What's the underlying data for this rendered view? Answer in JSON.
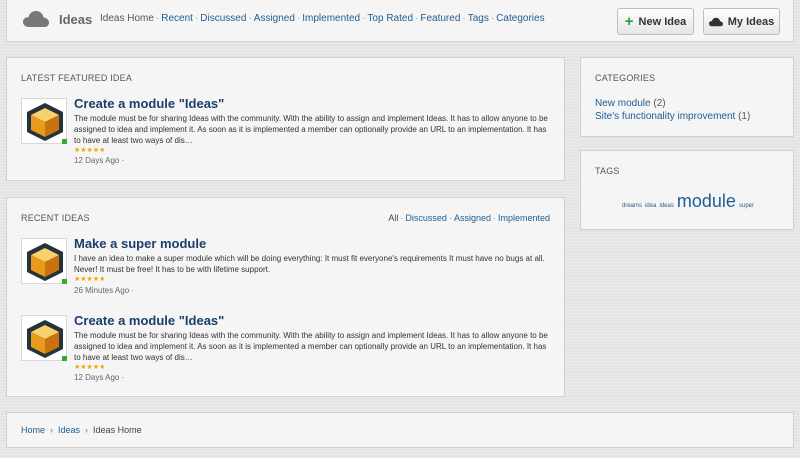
{
  "app": {
    "title": "Ideas"
  },
  "nav": {
    "items": [
      {
        "label": "Ideas Home",
        "current": true
      },
      {
        "label": "Recent"
      },
      {
        "label": "Discussed"
      },
      {
        "label": "Assigned"
      },
      {
        "label": "Implemented"
      },
      {
        "label": "Top Rated"
      },
      {
        "label": "Featured"
      },
      {
        "label": "Tags"
      },
      {
        "label": "Categories"
      }
    ],
    "separator": "·"
  },
  "buttons": {
    "new_idea": "New Idea",
    "my_ideas": "My Ideas"
  },
  "featured": {
    "title": "LATEST FEATURED IDEA",
    "idea": {
      "title": "Create a module \"Ideas\"",
      "description": "The module must be for sharing Ideas with the community. With the ability to assign and implement Ideas. It has to allow anyone to be assigned to idea and implement it. As soon as it is implemented a member can optionally provide an URL to an implementation. It has to have at least two ways of dis…",
      "rating": "★★★★★",
      "time": "12 Days Ago",
      "time_suffix": "·"
    }
  },
  "recent": {
    "title": "RECENT IDEAS",
    "filters": [
      {
        "label": "All",
        "active": true
      },
      {
        "label": "Discussed"
      },
      {
        "label": "Assigned"
      },
      {
        "label": "Implemented"
      }
    ],
    "ideas": [
      {
        "title": "Make a super module",
        "description": "I have an idea to make a super module which will be doing everything: It must fit everyone's requirements It must have no bugs at all. Never! It must be free! It has to be with lifetime support.",
        "rating": "★★★★★",
        "time": "26 Minutes Ago",
        "time_suffix": "·"
      },
      {
        "title": "Create a module \"Ideas\"",
        "description": "The module must be for sharing Ideas with the community. With the ability to assign and implement Ideas. It has to allow anyone to be assigned to idea and implement it. As soon as it is implemented a member can optionally provide an URL to an implementation. It has to have at least two ways of dis…",
        "rating": "★★★★★",
        "time": "12 Days Ago",
        "time_suffix": "·"
      }
    ]
  },
  "categories": {
    "title": "CATEGORIES",
    "items": [
      {
        "label": "New module",
        "count": "(2)"
      },
      {
        "label": "Site's functionality improvement",
        "count": "(1)"
      }
    ]
  },
  "tags": {
    "title": "TAGS",
    "items": [
      {
        "label": "dreams",
        "size": "s"
      },
      {
        "label": "idea",
        "size": "s"
      },
      {
        "label": "ideas",
        "size": "s"
      },
      {
        "label": "module",
        "size": "l"
      },
      {
        "label": "super",
        "size": "s"
      }
    ]
  },
  "breadcrumb": {
    "items": [
      "Home",
      "Ideas",
      "Ideas Home"
    ],
    "separator": "›"
  },
  "colors": {
    "link": "#1f5d92",
    "title": "#1b3e6a",
    "star": "#f0a800",
    "online": "#35a835",
    "plus": "#2e9a2e"
  },
  "icons": {
    "app": "cloud-icon",
    "new_idea": "plus-icon",
    "my_ideas": "cloud-icon",
    "idea_thumb": "cube-icon"
  }
}
